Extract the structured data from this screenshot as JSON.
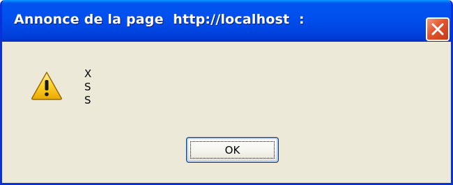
{
  "dialog": {
    "title": "Annonce de la page  http://localhost  :",
    "icon": "warning-icon",
    "message_lines": [
      "X",
      "S",
      "S"
    ],
    "ok_label": "OK",
    "close_icon": "close-icon"
  },
  "colors": {
    "titlebar": "#0053ee",
    "frame_border": "#0831d9",
    "dialog_background": "#ece9d8",
    "close_button": "#e2542f",
    "warning_fill": "#ffd228"
  }
}
